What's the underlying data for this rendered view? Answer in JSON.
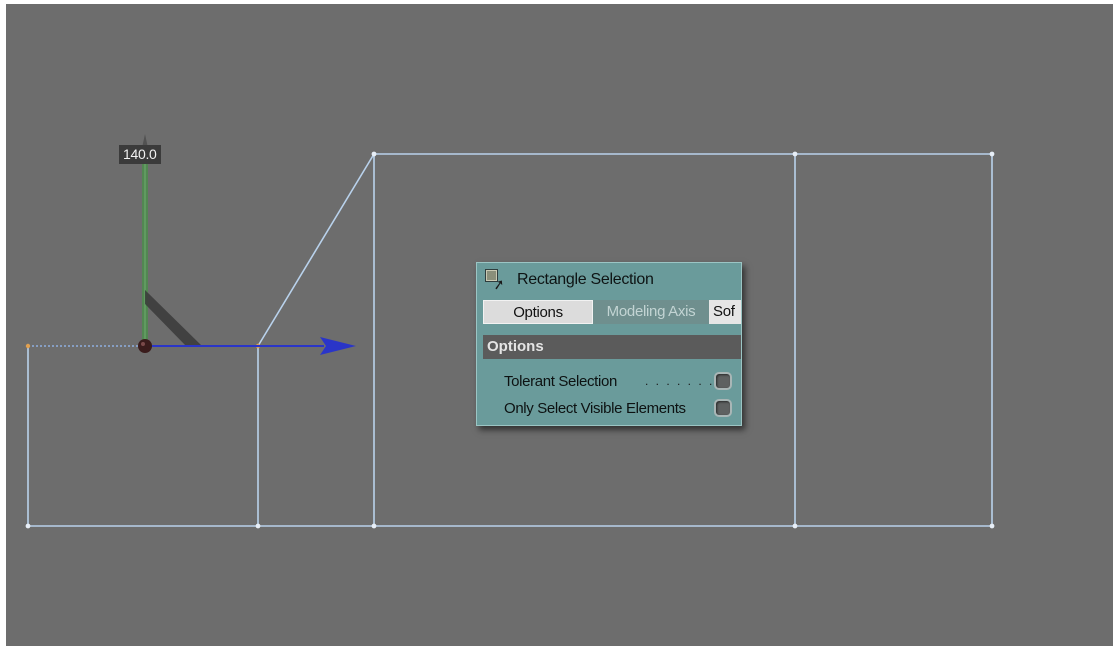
{
  "viewport": {
    "readout_value": "140.0"
  },
  "panel": {
    "title": "Rectangle Selection",
    "tool_icon": "rectangle-selection-icon",
    "tabs": [
      {
        "label": "Options",
        "active": true
      },
      {
        "label": "Modeling Axis",
        "active": false
      },
      {
        "label": "Sof",
        "active": false
      }
    ],
    "section_header": "Options",
    "options": [
      {
        "label": "Tolerant Selection",
        "leader": ". . . . . . .",
        "checked": false
      },
      {
        "label": "Only Select Visible Elements",
        "checked": false
      }
    ]
  },
  "colors": {
    "viewport_bg": "#6d6d6d",
    "wireframe": "#b9d2ec",
    "panel_bg": "#6a9b9b",
    "axis_x": "#2a35c8",
    "axis_y": "#4f8a4f"
  }
}
